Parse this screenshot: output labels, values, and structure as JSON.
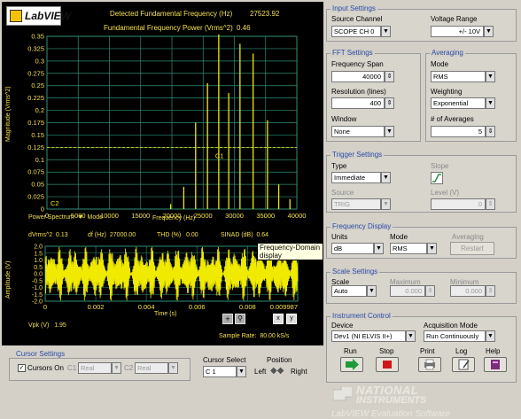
{
  "colors": {
    "plot_bg": "#000000",
    "trace": "#f0ea00",
    "grid": "#2f8f7a",
    "label": "#f4e04d",
    "group_title": "#2a4aa8"
  },
  "header": {
    "logo": "LabVIEW",
    "fund_freq_label": "Detected Fundamental Frequency (Hz)",
    "fund_freq_value": "27523.92",
    "fund_power_label": "Fundamental Frequency Power (Vrms^2)",
    "fund_power_value": "0.46"
  },
  "chart_data": [
    {
      "type": "line",
      "ylabel": "Magnitude (Vrms^2)",
      "xlabel": "Frequency (Hz)",
      "xlim": [
        0,
        40000
      ],
      "ylim": [
        0,
        0.35
      ],
      "x_ticks": [
        "0",
        "5000",
        "10000",
        "15000",
        "20000",
        "25000",
        "30000",
        "35000",
        "40000"
      ],
      "y_ticks": [
        "0",
        "0.025",
        "0.05",
        "0.075",
        "0.1",
        "0.125",
        "0.15",
        "0.175",
        "0.2",
        "0.225",
        "0.25",
        "0.275",
        "0.3",
        "0.325",
        "0.35"
      ],
      "peaks": [
        {
          "x": 19800,
          "y": 0.01
        },
        {
          "x": 21900,
          "y": 0.045
        },
        {
          "x": 23800,
          "y": 0.175
        },
        {
          "x": 25700,
          "y": 0.255
        },
        {
          "x": 27500,
          "y": 0.46
        },
        {
          "x": 29100,
          "y": 0.235
        },
        {
          "x": 30900,
          "y": 0.335
        },
        {
          "x": 33000,
          "y": 0.315
        },
        {
          "x": 35300,
          "y": 0.18
        },
        {
          "x": 37100,
          "y": 0.05
        },
        {
          "x": 38900,
          "y": 0.02
        }
      ],
      "cursors": [
        {
          "name": "C1",
          "x": 27500,
          "y": 0.125
        },
        {
          "name": "C2",
          "x": 0,
          "y": 0
        }
      ]
    },
    {
      "type": "line",
      "ylabel": "Amplitude (V)",
      "xlabel": "Time (s)",
      "xlim": [
        0,
        0.009987
      ],
      "ylim": [
        -2.0,
        2.0
      ],
      "x_ticks": [
        "0",
        "0.002",
        "0.004",
        "0.006",
        "0.008",
        "0.009987"
      ],
      "y_ticks": [
        "-2.0",
        "-1.5",
        "-1.0",
        "-0.5",
        "0.0",
        "0.5",
        "1.0",
        "1.5",
        "2.0"
      ],
      "signal_amplitude": 1.95
    }
  ],
  "spectrum": {
    "mode_label": "Power Spectrum",
    "mode_word": "Mode",
    "dvrms_label": "dVrms^2",
    "dvrms_value": "0.13",
    "df_label": "df (Hz)",
    "df_value": "27000.00",
    "thd_label": "THD (%)",
    "thd_value": "0.00",
    "sinad_label": "SINAD (dB)",
    "sinad_value": "0.64",
    "tooltip": "Frequency-Domain display"
  },
  "time": {
    "vpk_label": "Vpk (V)",
    "vpk_value": "1.95",
    "sample_rate_label": "Sample Rate:",
    "sample_rate_value": "80.00 kS/s"
  },
  "cursor_settings": {
    "title": "Cursor Settings",
    "cursors_on_label": "Cursors On",
    "c1_label": "C1",
    "c1_value": "Real",
    "c2_label": "C2",
    "c2_value": "Real",
    "cursor_select_label": "Cursor Select",
    "cursor_select_value": "C 1",
    "position_label": "Position",
    "left_label": "Left",
    "right_label": "Right"
  },
  "input_settings": {
    "title": "Input Settings",
    "source_channel_label": "Source Channel",
    "source_channel_value": "SCOPE CH 0",
    "voltage_range_label": "Voltage Range",
    "voltage_range_value": "+/- 10V"
  },
  "fft_settings": {
    "title": "FFT Settings",
    "span_label": "Frequency Span",
    "span_value": "40000",
    "resolution_label": "Resolution (lines)",
    "resolution_value": "400",
    "window_label": "Window",
    "window_value": "None"
  },
  "averaging": {
    "title": "Averaging",
    "mode_label": "Mode",
    "mode_value": "RMS",
    "weighting_label": "Weighting",
    "weighting_value": "Exponential",
    "num_label": "# of Averages",
    "num_value": "5"
  },
  "trigger_settings": {
    "title": "Trigger Settings",
    "type_label": "Type",
    "type_value": "Immediate",
    "slope_label": "Slope",
    "source_label": "Source",
    "source_value": "TRIG",
    "level_label": "Level (V)",
    "level_value": "0"
  },
  "frequency_display": {
    "title": "Frequency Display",
    "units_label": "Units",
    "units_value": "dB",
    "mode_label": "Mode",
    "mode_value": "RMS",
    "averaging_label": "Averaging",
    "restart_label": "Restart"
  },
  "scale_settings": {
    "title": "Scale Settings",
    "scale_label": "Scale",
    "scale_value": "Auto",
    "max_label": "Maximum",
    "max_value": "0.000",
    "min_label": "Minimum",
    "min_value": "0.000"
  },
  "instrument_control": {
    "title": "Instrument Control",
    "device_label": "Device",
    "device_value": "Dev1 (NI ELVIS II+)",
    "acq_label": "Acquisition Mode",
    "acq_value": "Run Continuously",
    "run_label": "Run",
    "stop_label": "Stop",
    "print_label": "Print",
    "log_label": "Log",
    "help_label": "Help"
  },
  "branding": {
    "company_line1": "NATIONAL",
    "company_line2": "INSTRUMENTS",
    "footer": "LabVIEW Evaluation Software"
  }
}
